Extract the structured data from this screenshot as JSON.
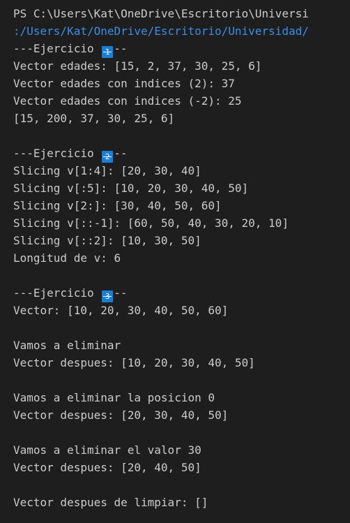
{
  "terminal": {
    "prompt_line": "PS C:\\Users\\Kat\\OneDrive\\Escritorio\\Universi",
    "path_line": ":/Users/Kat/OneDrive/Escritorio/Universidad/",
    "ex1": {
      "prefix": "---Ejercicio ",
      "badge": "1",
      "suffix": "--",
      "lines": [
        "Vector edades: [15, 2, 37, 30, 25, 6]",
        "Vector edades con indices (2): 37",
        "Vector edades con indices (-2): 25",
        "[15, 200, 37, 30, 25, 6]"
      ]
    },
    "ex2": {
      "prefix": "---Ejercicio ",
      "badge": "2",
      "suffix": "--",
      "lines": [
        "Slicing v[1:4]: [20, 30, 40]",
        "Slicing v[:5]: [10, 20, 30, 40, 50]",
        "Slicing v[2:]: [30, 40, 50, 60]",
        "Slicing v[::-1]: [60, 50, 40, 30, 20, 10]",
        "Slicing v[::2]: [10, 30, 50]",
        "Longitud de v: 6"
      ]
    },
    "ex3": {
      "prefix": "---Ejercicio ",
      "badge": "3",
      "suffix": "--",
      "lines": [
        "Vector: [10, 20, 30, 40, 50, 60]",
        "",
        "Vamos a eliminar",
        "Vector despues: [10, 20, 30, 40, 50]",
        "",
        "Vamos a eliminar la posicion 0",
        "Vector despues: [20, 30, 40, 50]",
        "",
        "Vamos a eliminar el valor 30",
        "Vector despues: [20, 40, 50]",
        "",
        "Vector despues de limpiar: []"
      ]
    }
  }
}
